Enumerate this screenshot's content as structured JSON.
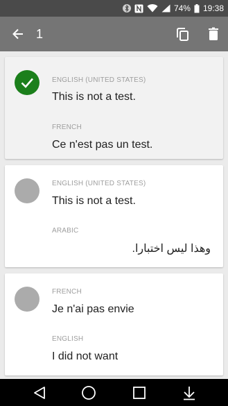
{
  "status_bar": {
    "battery": "74%",
    "time": "19:38"
  },
  "app_bar": {
    "selected_count": "1"
  },
  "cards": [
    {
      "source_lang": "ENGLISH (UNITED STATES)",
      "source_text": "This is not a test.",
      "target_lang": "FRENCH",
      "target_text": "Ce n'est pas un test.",
      "selected": true
    },
    {
      "source_lang": "ENGLISH (UNITED STATES)",
      "source_text": "This is not a test.",
      "target_lang": "ARABIC",
      "target_text": "وهذا ليس اختبارا.",
      "selected": false
    },
    {
      "source_lang": "FRENCH",
      "source_text": "Je n'ai pas envie",
      "target_lang": "ENGLISH",
      "target_text": "I did not want",
      "selected": false
    }
  ],
  "colors": {
    "app_bar": "#757575",
    "status_bar": "#4a4a4a",
    "check": "#1b7f1b",
    "avatar": "#ababab"
  }
}
